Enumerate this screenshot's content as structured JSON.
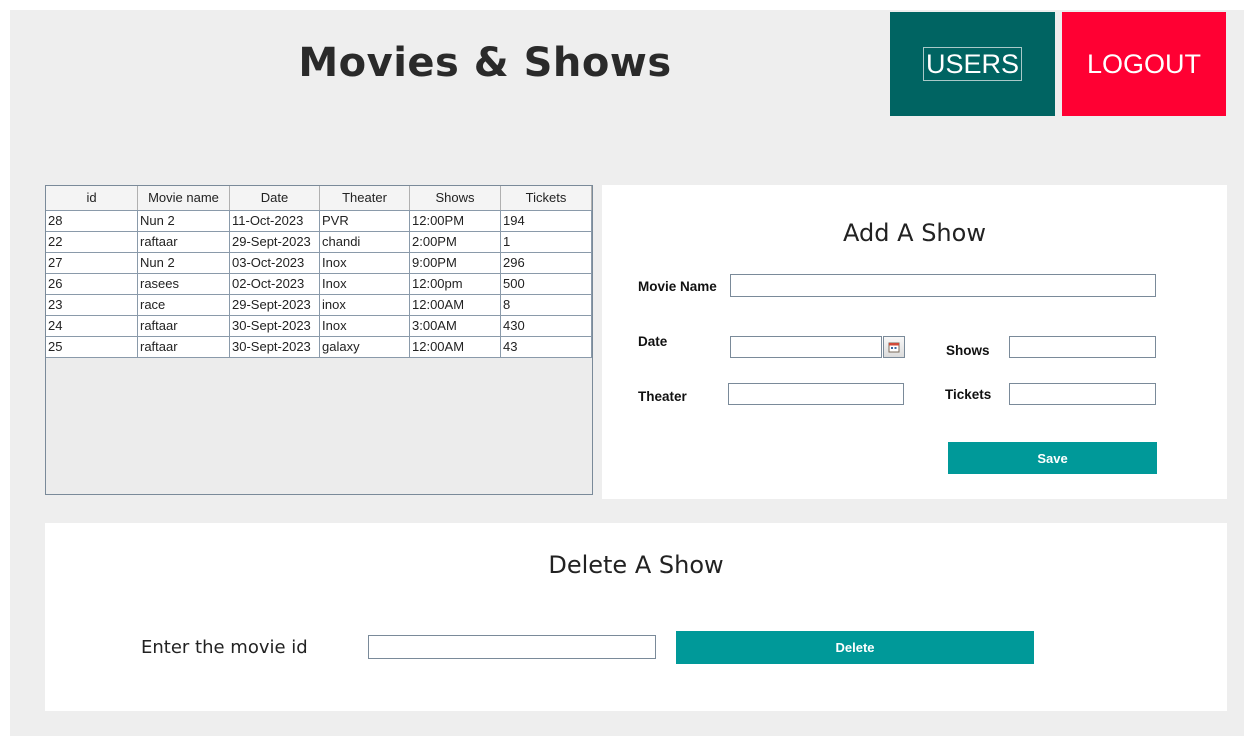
{
  "header": {
    "title": "Movies & Shows",
    "users_label": "USERS",
    "logout_label": "LOGOUT"
  },
  "colors": {
    "users_button": "#006462",
    "logout_button": "#ff0033",
    "action_button": "#009999"
  },
  "table": {
    "columns": [
      "id",
      "Movie name",
      "Date",
      "Theater",
      "Shows",
      "Tickets"
    ],
    "rows": [
      [
        "28",
        "Nun 2",
        "11-Oct-2023",
        "PVR",
        "12:00PM",
        "194"
      ],
      [
        "22",
        "raftaar",
        "29-Sept-2023",
        "chandi",
        "2:00PM",
        "1"
      ],
      [
        "27",
        "Nun 2",
        "03-Oct-2023",
        "Inox",
        "9:00PM",
        "296"
      ],
      [
        "26",
        "rasees",
        "02-Oct-2023",
        "Inox",
        "12:00pm",
        "500"
      ],
      [
        "23",
        "race",
        "29-Sept-2023",
        "inox",
        "12:00AM",
        "8"
      ],
      [
        "24",
        "raftaar",
        "30-Sept-2023",
        "Inox",
        "3:00AM",
        "430"
      ],
      [
        "25",
        "raftaar",
        "30-Sept-2023",
        "galaxy",
        "12:00AM",
        "43"
      ]
    ]
  },
  "add_show": {
    "title": "Add A Show",
    "movie_name_label": "Movie Name",
    "movie_name_value": "",
    "date_label": "Date",
    "date_value": "",
    "shows_label": "Shows",
    "shows_value": "",
    "theater_label": "Theater",
    "theater_value": "",
    "tickets_label": "Tickets",
    "tickets_value": "",
    "save_label": "Save",
    "calendar_icon": "calendar-icon"
  },
  "delete_show": {
    "title": "Delete A Show",
    "movie_id_label": "Enter the movie id",
    "movie_id_value": "",
    "delete_label": "Delete"
  }
}
